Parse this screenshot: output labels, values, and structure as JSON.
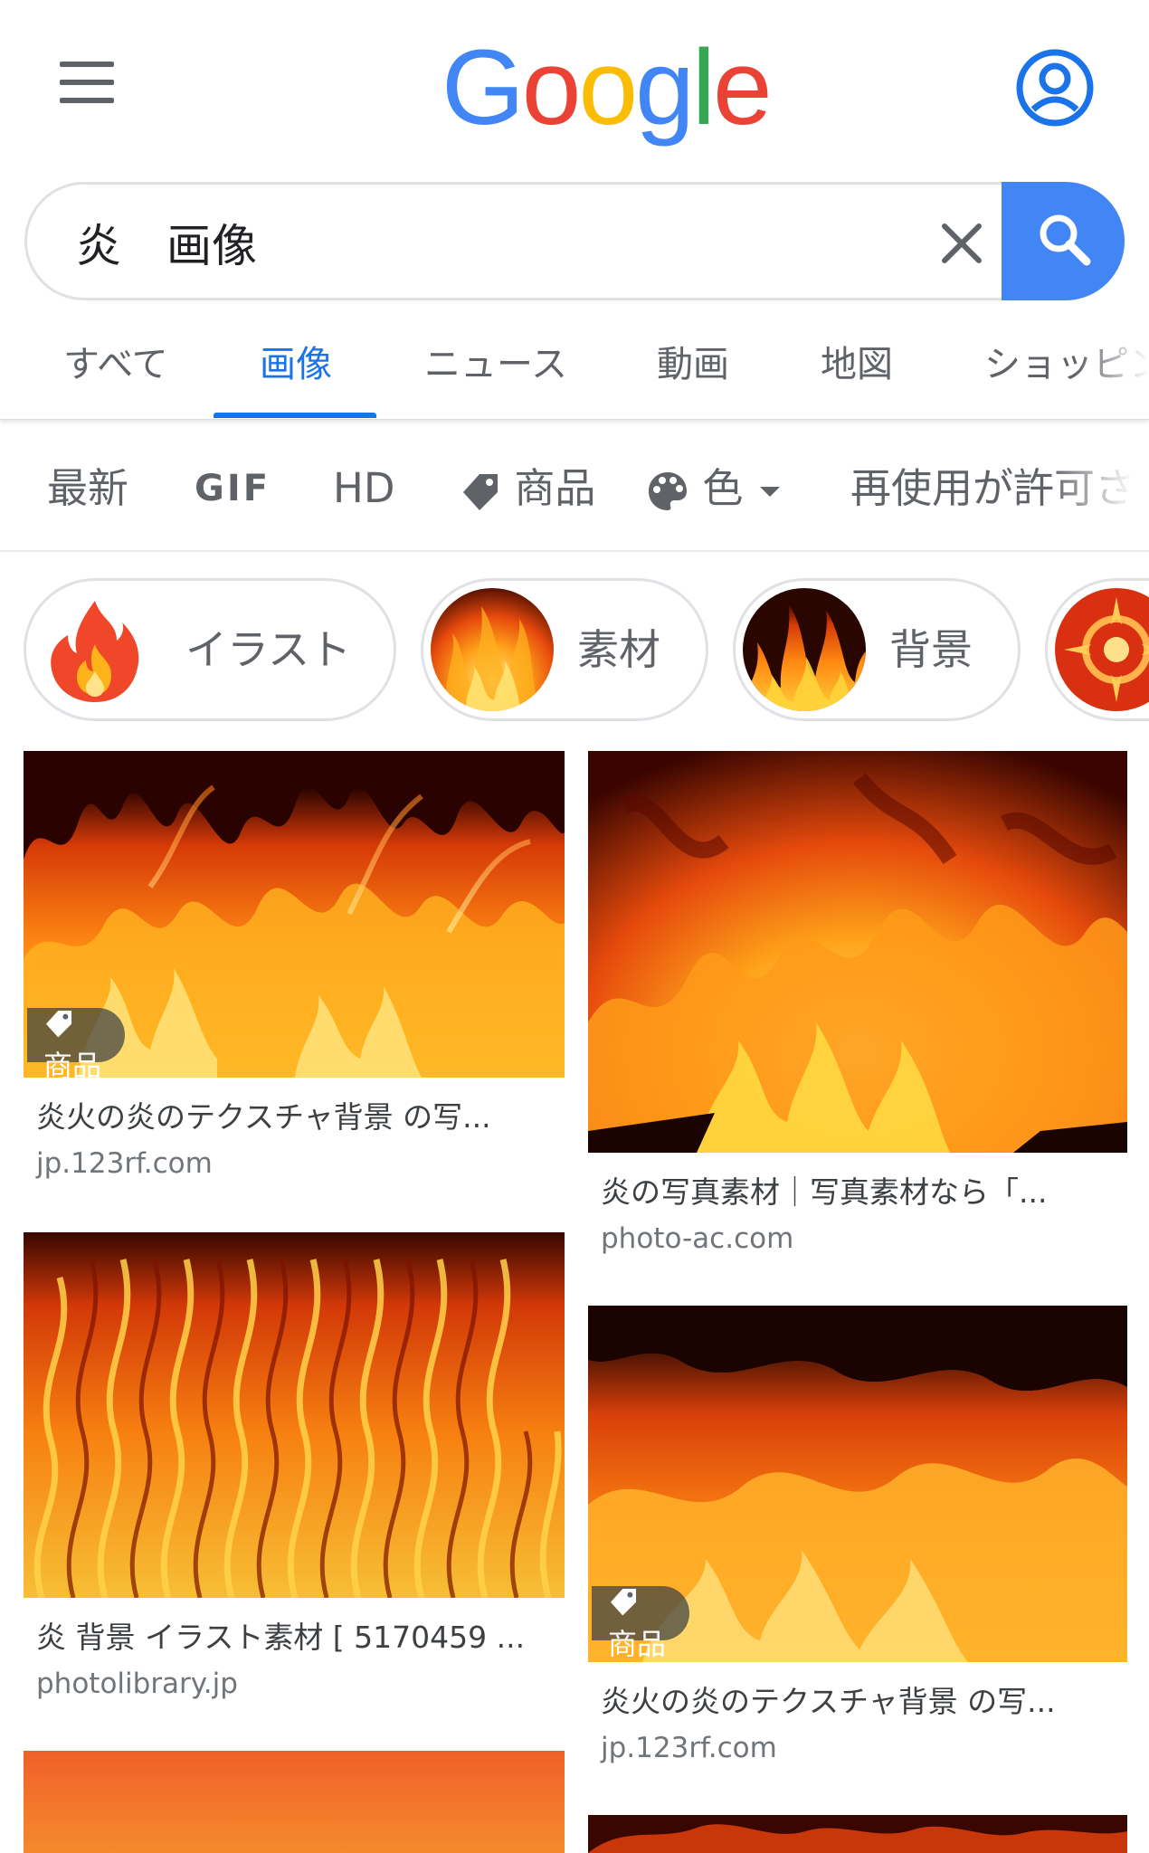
{
  "header": {
    "logo_letters": [
      "G",
      "o",
      "o",
      "g",
      "l",
      "e"
    ]
  },
  "search": {
    "query": "炎　画像"
  },
  "tabs": [
    {
      "label": "すべて"
    },
    {
      "label": "画像"
    },
    {
      "label": "ニュース"
    },
    {
      "label": "動画"
    },
    {
      "label": "地図"
    },
    {
      "label": "ショッピング"
    }
  ],
  "filters": {
    "latest": "最新",
    "gif": "GIF",
    "hd": "HD",
    "products": "商品",
    "color": "色",
    "reuse": "再使用が許可されたもの"
  },
  "chips": [
    {
      "label": "イラスト"
    },
    {
      "label": "素材"
    },
    {
      "label": "背景"
    }
  ],
  "results": [
    {
      "badge": "商品",
      "title": "炎火の炎のテクスチャ背景 の写...",
      "source": "jp.123rf.com"
    },
    {
      "title": "炎の写真素材｜写真素材なら「...",
      "source": "photo-ac.com"
    },
    {
      "title": "炎 背景 イラスト素材 [ 5170459 ...",
      "source": "photolibrary.jp"
    },
    {
      "badge": "商品",
      "title": "炎火の炎のテクスチャ背景 の写...",
      "source": "jp.123rf.com"
    }
  ],
  "colors": {
    "accent": "#1a73e8",
    "search_button": "#4285f4",
    "logo": [
      "#4285F4",
      "#EA4335",
      "#FBBC05",
      "#4285F4",
      "#34A853",
      "#EA4335"
    ]
  },
  "icons": [
    "menu-icon",
    "account-icon",
    "clear-icon",
    "search-icon",
    "tag-icon",
    "palette-icon",
    "dropdown-arrow-icon",
    "flame-icon"
  ]
}
